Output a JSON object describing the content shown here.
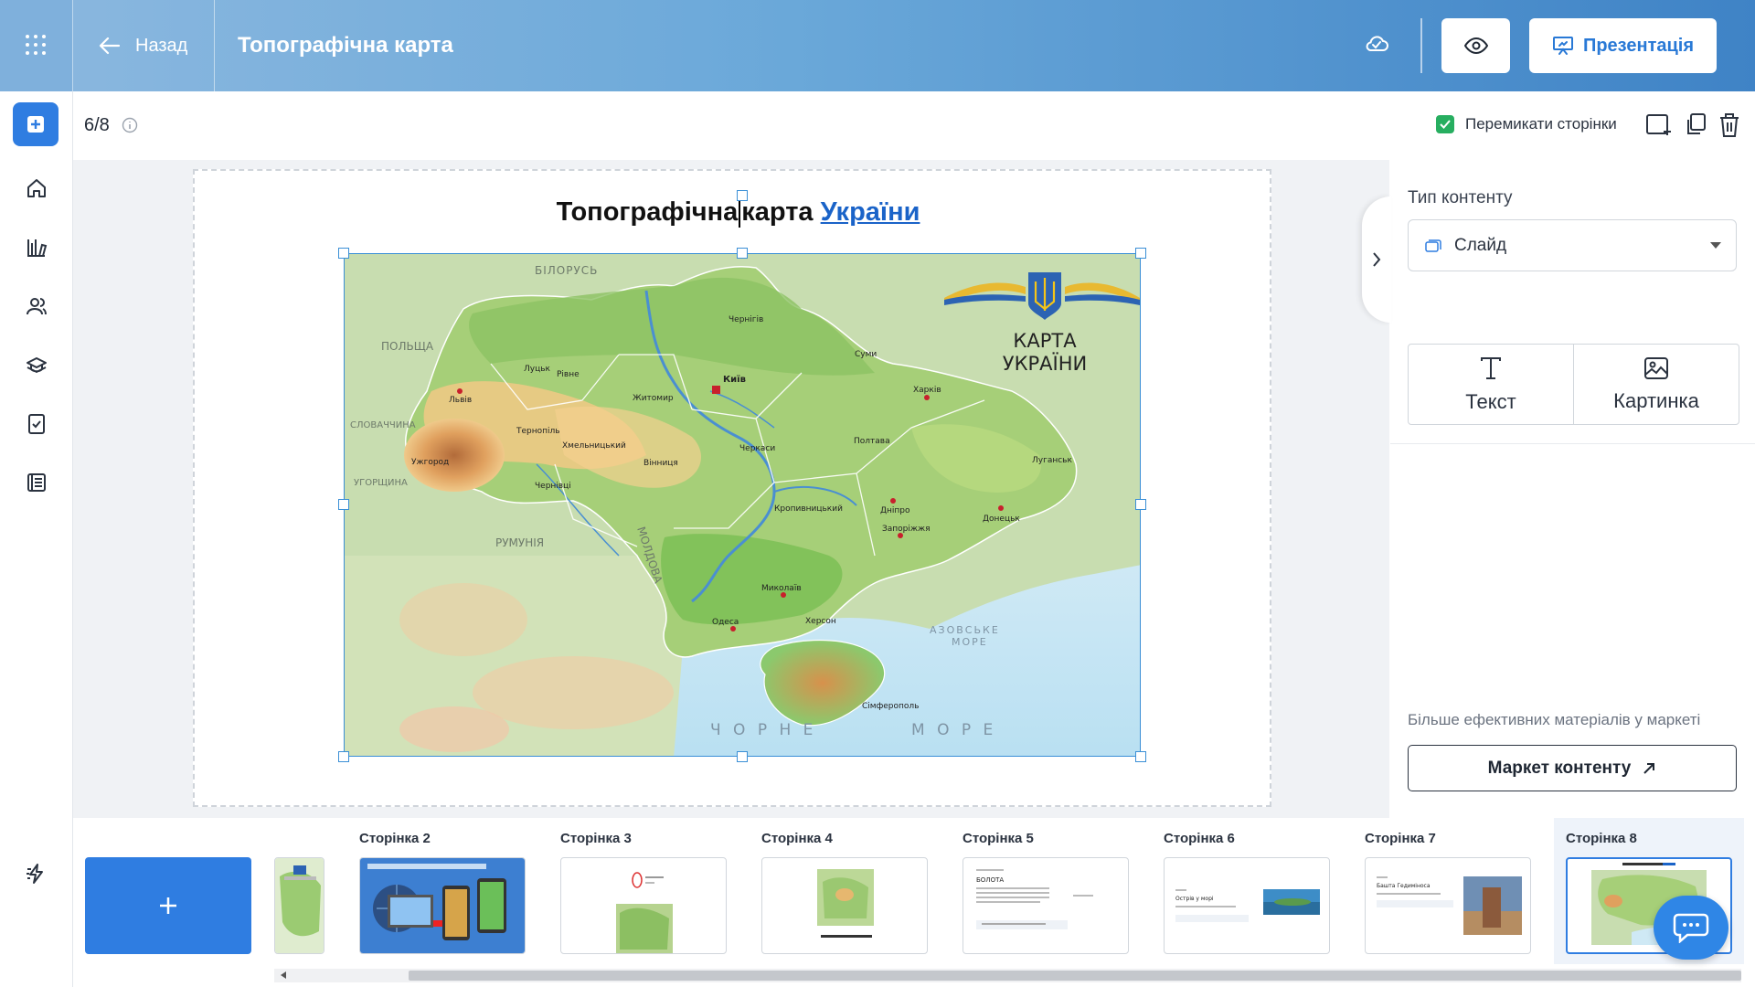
{
  "header": {
    "back_label": "Назад",
    "title": "Топографічна карта",
    "present_label": "Презентація"
  },
  "toolbar": {
    "page_counter": "6/8",
    "switch_pages_label": "Перемикати сторінки",
    "switch_pages_checked": true
  },
  "slide": {
    "title_part1": "Топографічна",
    "title_part2": "карта",
    "title_link": "України"
  },
  "map": {
    "heading_line1": "КАРТА",
    "heading_line2": "УКРАЇНИ",
    "labels": {
      "belarus": "БІЛОРУСЬ",
      "poland": "ПОЛЬЩА",
      "slovakia": "СЛОВАЧЧИНА",
      "hungary": "УГОРЩИНА",
      "romania": "РУМУНІЯ",
      "moldova": "МОЛДОВА",
      "black_sea_1": "Ч О Р Н Е",
      "black_sea_2": "М О Р Е",
      "azov_1": "АЗОВСЬКЕ",
      "azov_2": "МОРЕ",
      "kyiv": "Київ",
      "kharkiv": "Харків",
      "lviv": "Львів",
      "odesa": "Одеса",
      "dnipro": "Дніпро",
      "zaporizhzhia": "Запоріжжя",
      "kherson": "Херсон",
      "mykolaiv": "Миколаїв",
      "donetsk": "Донецьк",
      "luhansk": "Луганськ",
      "simferopol": "Сімферополь",
      "poltava": "Полтава",
      "zhytomyr": "Житомир",
      "vinnytsia": "Вінниця",
      "chernihiv": "Чернігів",
      "sumy": "Суми",
      "cherkasy": "Черкаси",
      "rivne": "Рівне",
      "lutsk": "Луцьк",
      "ternopil": "Тернопіль",
      "khmelnytskyi": "Хмельницький",
      "uzhhorod": "Ужгород",
      "chernivtsi": "Чернівці",
      "kropyvnytskyi": "Кропивницький"
    }
  },
  "right_panel": {
    "content_type_label": "Тип контенту",
    "content_type_value": "Слайд",
    "text_btn": "Текст",
    "image_btn": "Картинка",
    "market_note": "Більше ефективних матеріалів у маркеті",
    "market_btn": "Маркет контенту"
  },
  "filmstrip": {
    "pages": [
      {
        "label": "Сторінка 2"
      },
      {
        "label": "Сторінка 3"
      },
      {
        "label": "Сторінка 4"
      },
      {
        "label": "Сторінка 5",
        "snippet": "БОЛОТА"
      },
      {
        "label": "Сторінка 6",
        "snippet": "Острів у морі"
      },
      {
        "label": "Сторінка 7",
        "snippet": "Башта Гедиміноса"
      },
      {
        "label": "Сторінка 8"
      }
    ]
  },
  "colors": {
    "accent": "#2f7de1",
    "checkbox": "#27ae60",
    "link": "#1a63c8"
  }
}
